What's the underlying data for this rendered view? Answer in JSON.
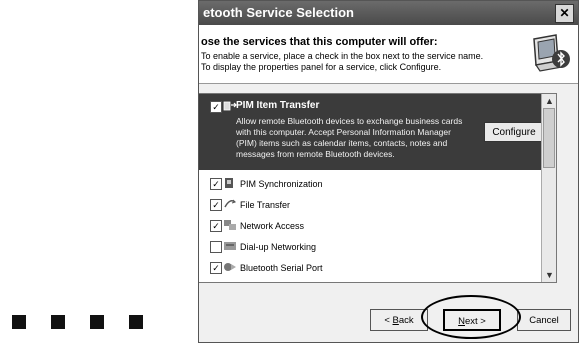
{
  "window": {
    "title": "etooth Service Selection",
    "close_glyph": "✕"
  },
  "header": {
    "heading": "ose the services that this computer will offer:",
    "instructions": [
      "To enable a service, place a check in the box next to the service name.",
      "To display the properties panel for a service, click Configure."
    ],
    "icon": "bluetooth-computer-icon"
  },
  "services": {
    "selected": {
      "label": "PIM Item Transfer",
      "checked": true,
      "icon": "pim-transfer-icon",
      "description": [
        "Allow remote Bluetooth devices to exchange business cards",
        "with this computer. Accept Personal Information Manager",
        "(PIM) items such as calendar items, contacts, notes and",
        "messages from remote Bluetooth devices."
      ],
      "configure_label": "Configure"
    },
    "items": [
      {
        "label": "PIM Synchronization",
        "checked": true,
        "icon": "sync-icon"
      },
      {
        "label": "File Transfer",
        "checked": true,
        "icon": "file-transfer-icon"
      },
      {
        "label": "Network Access",
        "checked": true,
        "icon": "network-icon"
      },
      {
        "label": "Dial-up Networking",
        "checked": false,
        "icon": "dialup-icon"
      },
      {
        "label": "Bluetooth Serial Port",
        "checked": true,
        "icon": "serial-port-icon"
      }
    ]
  },
  "buttons": {
    "back": {
      "pre": "< ",
      "accel": "B",
      "rest": "ack"
    },
    "next": {
      "accel": "N",
      "rest": "ext >"
    },
    "cancel": "Cancel"
  },
  "check_glyph": "✓"
}
